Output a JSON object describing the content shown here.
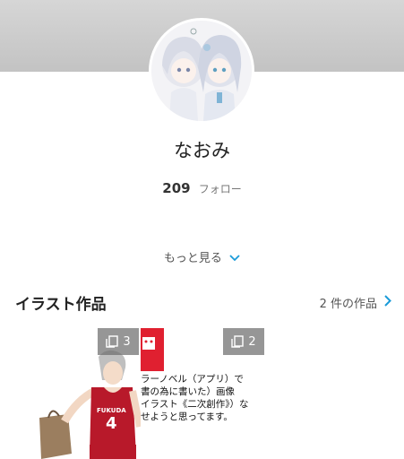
{
  "profile": {
    "username": "なおみ",
    "follow_count": "209",
    "follow_label": "フォロー",
    "more_label": "もっと見る"
  },
  "section": {
    "title": "イラスト作品",
    "link_label": "2 件の作品"
  },
  "works": [
    {
      "page_count": "3",
      "jersey_name": "FUKUDA",
      "jersey_number": "4"
    },
    {
      "page_count": "2",
      "text_lines": [
        "ラーノベル（アプリ）で",
        "書の為に書いた）画像",
        "イラスト《二次創作》）な",
        "せようと思ってます。"
      ]
    }
  ],
  "colors": {
    "accent": "#1a9bd8",
    "jersey": "#b8192a"
  }
}
